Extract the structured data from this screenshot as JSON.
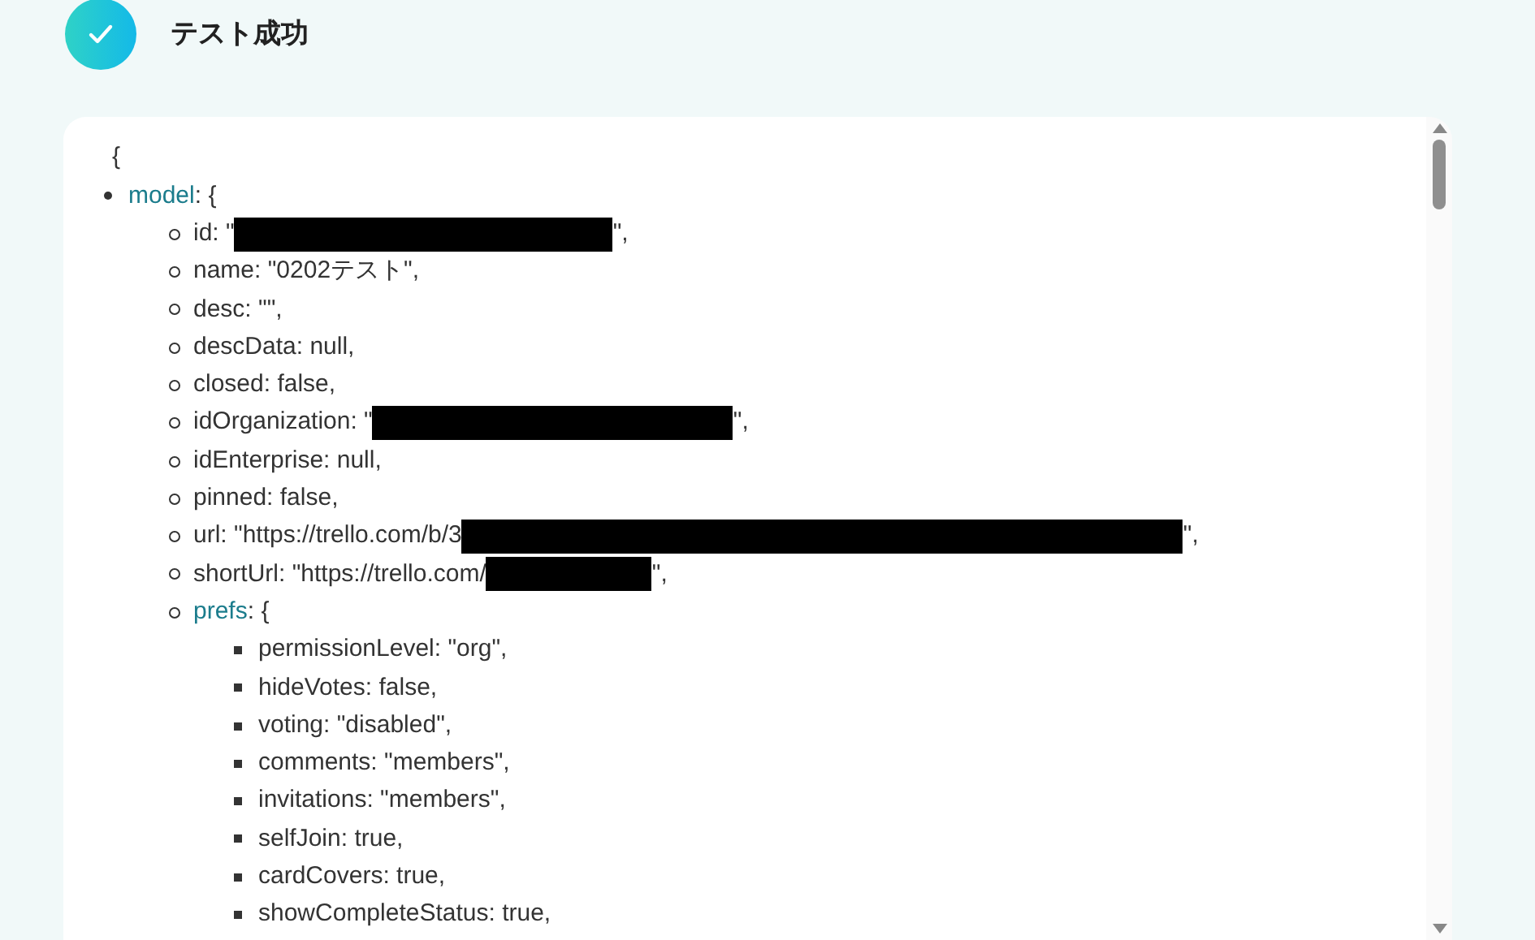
{
  "header": {
    "title": "テスト成功",
    "success": true
  },
  "json_view": {
    "open": "{",
    "items": [
      {
        "key": "model",
        "text": ": {",
        "children": [
          {
            "key": "id",
            "text": ": \"",
            "redacted": true,
            "after": "\","
          },
          {
            "key": "name",
            "text": ": \"0202テスト\","
          },
          {
            "key": "desc",
            "text": ": \"\","
          },
          {
            "key": "descData",
            "text": ": null,"
          },
          {
            "key": "closed",
            "text": ": false,"
          },
          {
            "key": "idOrganization",
            "text": ": \"",
            "redacted": true,
            "after": "\","
          },
          {
            "key": "idEnterprise",
            "text": ": null,"
          },
          {
            "key": "pinned",
            "text": ": false,"
          },
          {
            "key": "url",
            "text": ": \"https://trello.com/b/3",
            "redacted": true,
            "after": "\","
          },
          {
            "key": "shortUrl",
            "text": ": \"https://trello.com/",
            "redacted": true,
            "after": "\","
          },
          {
            "key": "prefs",
            "text": ": {",
            "children": [
              {
                "key": "permissionLevel",
                "text": ": \"org\","
              },
              {
                "key": "hideVotes",
                "text": ": false,"
              },
              {
                "key": "voting",
                "text": ": \"disabled\","
              },
              {
                "key": "comments",
                "text": ": \"members\","
              },
              {
                "key": "invitations",
                "text": ": \"members\","
              },
              {
                "key": "selfJoin",
                "text": ": true,"
              },
              {
                "key": "cardCovers",
                "text": ": true,"
              },
              {
                "key": "showCompleteStatus",
                "text": ": true,"
              }
            ]
          }
        ]
      }
    ]
  }
}
